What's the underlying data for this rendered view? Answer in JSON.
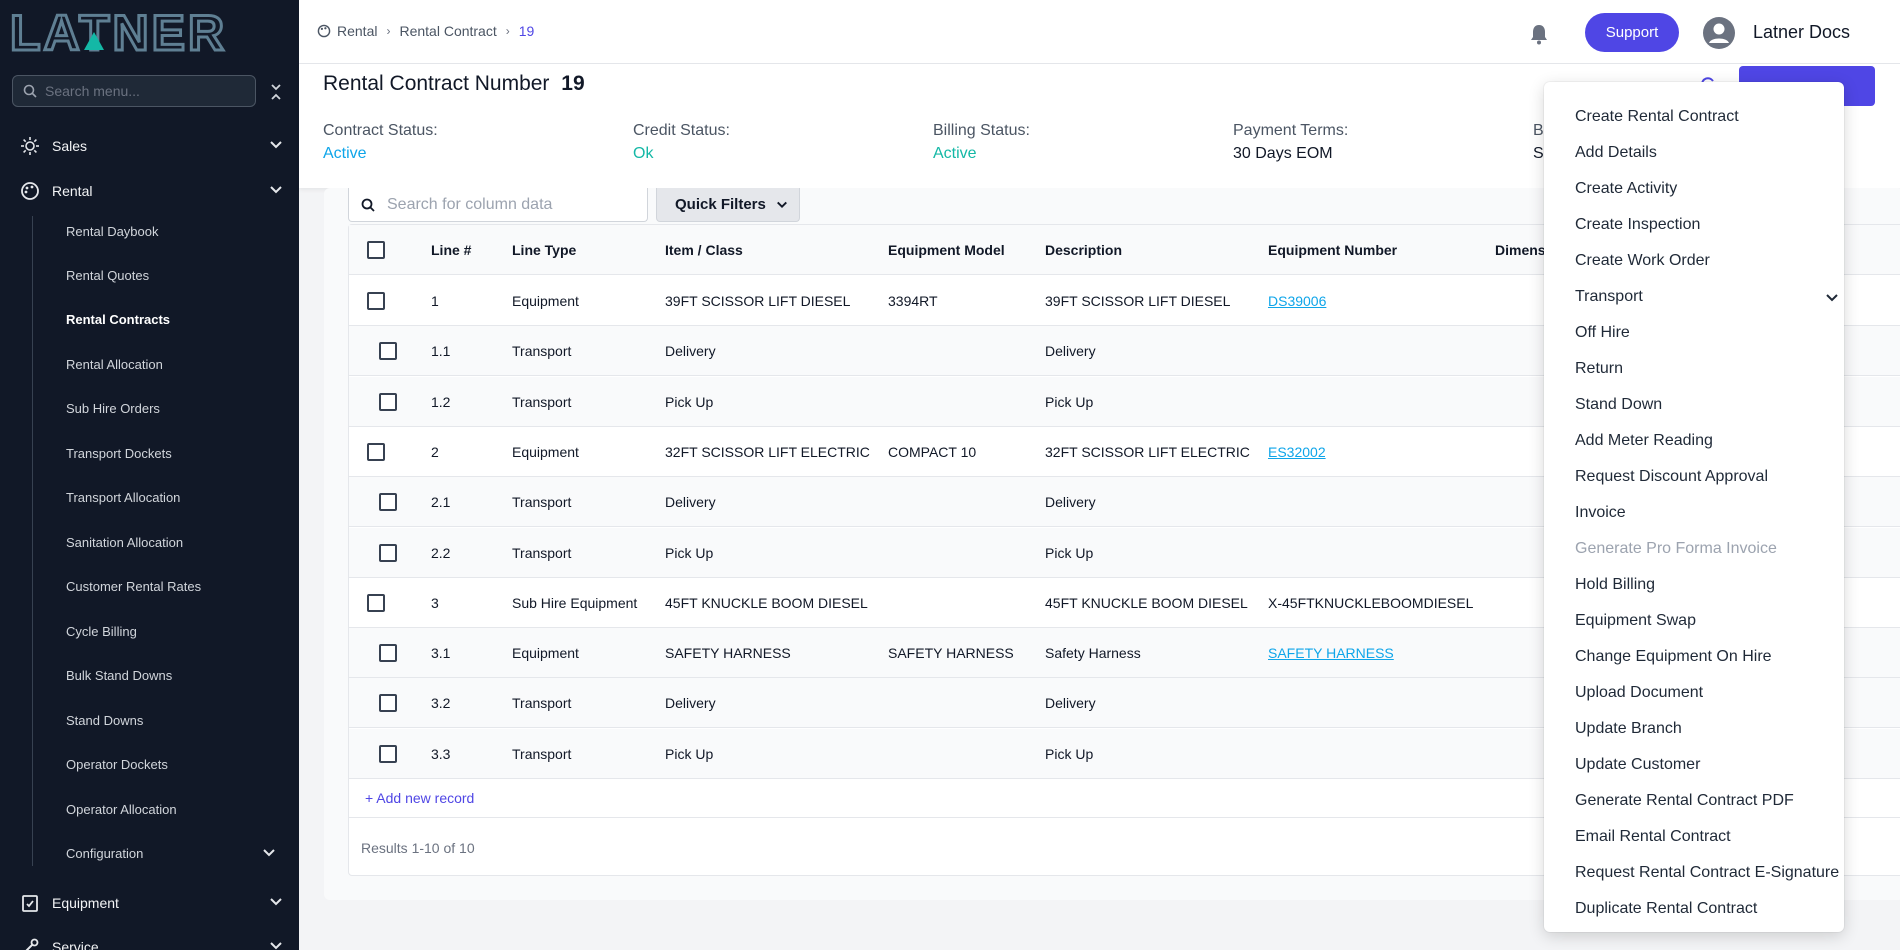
{
  "brand": {
    "logo_text": "LATNER"
  },
  "sidebar": {
    "search_placeholder": "Search menu...",
    "groups": [
      {
        "label": "Sales",
        "icon": "sales-gear-icon"
      },
      {
        "label": "Rental",
        "icon": "rental-palette-icon"
      },
      {
        "label": "Equipment",
        "icon": "equipment-clipboard-icon"
      },
      {
        "label": "Service",
        "icon": "service-wrench-icon"
      }
    ],
    "rental_items": [
      "Rental Daybook",
      "Rental Quotes",
      "Rental Contracts",
      "Rental Allocation",
      "Sub Hire Orders",
      "Transport Dockets",
      "Transport Allocation",
      "Sanitation Allocation",
      "Customer Rental Rates",
      "Cycle Billing",
      "Bulk Stand Downs",
      "Stand Downs",
      "Operator Dockets",
      "Operator Allocation",
      "Configuration"
    ],
    "active_item": "Rental Contracts"
  },
  "header": {
    "breadcrumb": [
      "Rental",
      "Rental Contract",
      "19"
    ],
    "support_label": "Support",
    "user_name": "Latner Docs"
  },
  "contract": {
    "title_label": "Rental Contract Number",
    "number": "19",
    "statuses": [
      {
        "label": "Contract Status:",
        "value": "Active"
      },
      {
        "label": "Credit Status:",
        "value": "Ok"
      },
      {
        "label": "Billing Status:",
        "value": "Active"
      },
      {
        "label": "Payment Terms:",
        "value": "30 Days EOM"
      },
      {
        "label": "B",
        "value": "S"
      }
    ]
  },
  "table": {
    "search_placeholder": "Search for column data",
    "quick_filters_label": "Quick Filters",
    "columns": [
      "Line #",
      "Line Type",
      "Item / Class",
      "Equipment Model",
      "Description",
      "Equipment Number",
      "Dimens"
    ],
    "rows": [
      {
        "line": "1",
        "type": "Equipment",
        "item": "39FT SCISSOR LIFT DIESEL",
        "model": "3394RT",
        "desc": "39FT SCISSOR LIFT DIESEL",
        "equip": "DS39006",
        "link": true,
        "sub": false
      },
      {
        "line": "1.1",
        "type": "Transport",
        "item": "Delivery",
        "model": "",
        "desc": "Delivery",
        "equip": "",
        "link": false,
        "sub": true
      },
      {
        "line": "1.2",
        "type": "Transport",
        "item": "Pick Up",
        "model": "",
        "desc": "Pick Up",
        "equip": "",
        "link": false,
        "sub": true
      },
      {
        "line": "2",
        "type": "Equipment",
        "item": "32FT SCISSOR LIFT ELECTRIC",
        "model": "COMPACT 10",
        "desc": "32FT SCISSOR LIFT ELECTRIC",
        "equip": "ES32002",
        "link": true,
        "sub": false
      },
      {
        "line": "2.1",
        "type": "Transport",
        "item": "Delivery",
        "model": "",
        "desc": "Delivery",
        "equip": "",
        "link": false,
        "sub": true
      },
      {
        "line": "2.2",
        "type": "Transport",
        "item": "Pick Up",
        "model": "",
        "desc": "Pick Up",
        "equip": "",
        "link": false,
        "sub": true
      },
      {
        "line": "3",
        "type": "Sub Hire Equipment",
        "item": "45FT KNUCKLE BOOM DIESEL",
        "model": "",
        "desc": "45FT KNUCKLE BOOM DIESEL",
        "equip": "X-45FTKNUCKLEBOOMDIESEL",
        "link": false,
        "sub": false
      },
      {
        "line": "3.1",
        "type": "Equipment",
        "item": "SAFETY HARNESS",
        "model": "SAFETY HARNESS",
        "desc": "Safety Harness",
        "equip": "SAFETY HARNESS",
        "link": true,
        "sub": true
      },
      {
        "line": "3.2",
        "type": "Transport",
        "item": "Delivery",
        "model": "",
        "desc": "Delivery",
        "equip": "",
        "link": false,
        "sub": true
      },
      {
        "line": "3.3",
        "type": "Transport",
        "item": "Pick Up",
        "model": "",
        "desc": "Pick Up",
        "equip": "",
        "link": false,
        "sub": true
      }
    ],
    "add_record_label": "+ Add new record",
    "results_text": "Results 1-10 of 10"
  },
  "actions_menu": {
    "items": [
      {
        "label": "Create Rental Contract",
        "disabled": false
      },
      {
        "label": "Add Details",
        "disabled": false
      },
      {
        "label": "Create Activity",
        "disabled": false
      },
      {
        "label": "Create Inspection",
        "disabled": false
      },
      {
        "label": "Create Work Order",
        "disabled": false
      },
      {
        "label": "Transport",
        "disabled": false,
        "submenu": true
      },
      {
        "label": "Off Hire",
        "disabled": false
      },
      {
        "label": "Return",
        "disabled": false
      },
      {
        "label": "Stand Down",
        "disabled": false
      },
      {
        "label": "Add Meter Reading",
        "disabled": false
      },
      {
        "label": "Request Discount Approval",
        "disabled": false
      },
      {
        "label": "Invoice",
        "disabled": false
      },
      {
        "label": "Generate Pro Forma Invoice",
        "disabled": true
      },
      {
        "label": "Hold Billing",
        "disabled": false
      },
      {
        "label": "Equipment Swap",
        "disabled": false
      },
      {
        "label": "Change Equipment On Hire",
        "disabled": false
      },
      {
        "label": "Upload Document",
        "disabled": false
      },
      {
        "label": "Update Branch",
        "disabled": false
      },
      {
        "label": "Update Customer",
        "disabled": false
      },
      {
        "label": "Generate Rental Contract PDF",
        "disabled": false
      },
      {
        "label": "Email Rental Contract",
        "disabled": false
      },
      {
        "label": "Request Rental Contract E-Signature",
        "disabled": false
      },
      {
        "label": "Duplicate Rental Contract",
        "disabled": false
      }
    ]
  },
  "colors": {
    "sidebar_bg": "#111827",
    "accent": "#4f46e5",
    "status_ok": "#14b8a6",
    "link": "#0ea5e9"
  }
}
